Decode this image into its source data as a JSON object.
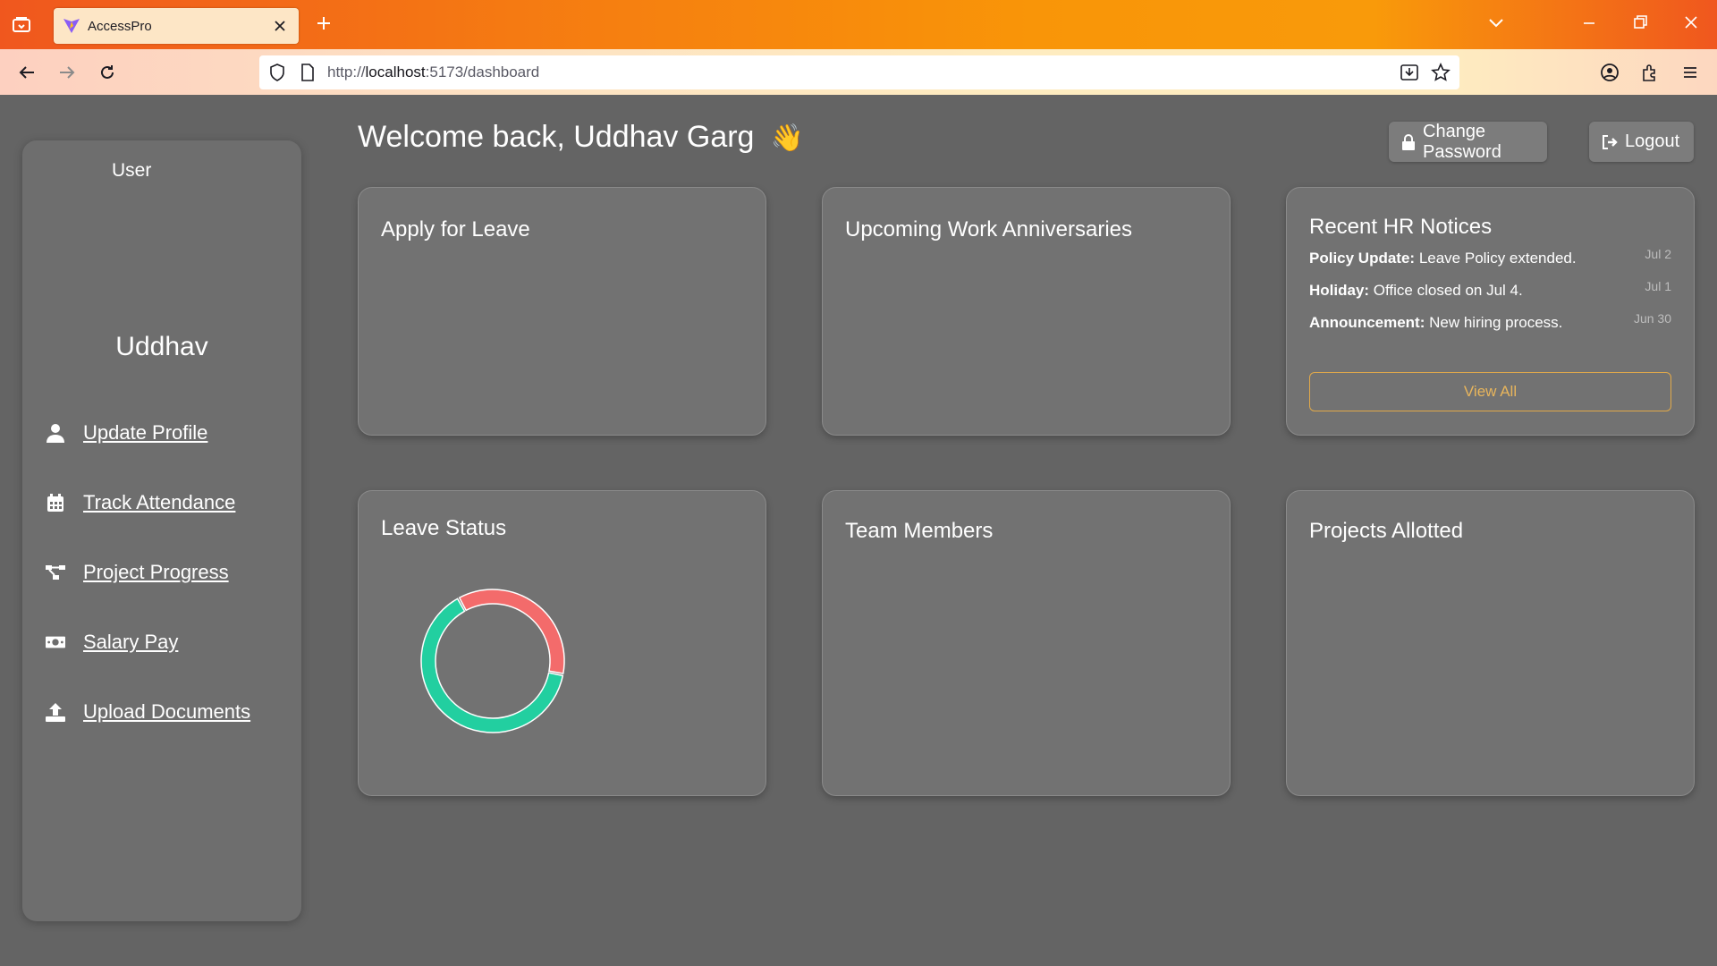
{
  "browser": {
    "tab_title": "AccessPro",
    "url_prefix": "http://",
    "url_host": "localhost",
    "url_rest": ":5173/dashboard"
  },
  "sidebar": {
    "role": "User",
    "name": "Uddhav",
    "items": [
      {
        "label": "Update Profile",
        "icon": "user-icon"
      },
      {
        "label": "Track Attendance",
        "icon": "calendar-icon"
      },
      {
        "label": "Project Progress",
        "icon": "project-diagram-icon"
      },
      {
        "label": "Salary Pay",
        "icon": "money-bill-icon"
      },
      {
        "label": "Upload Documents",
        "icon": "upload-icon"
      }
    ]
  },
  "header": {
    "welcome": "Welcome back, Uddhav Garg",
    "wave": "👋",
    "change_password": "Change Password",
    "logout": "Logout"
  },
  "cards": {
    "apply_leave": "Apply for Leave",
    "anniversaries": "Upcoming Work Anniversaries",
    "hr_notices": {
      "title": "Recent HR Notices",
      "items": [
        {
          "label": "Policy Update:",
          "text": " Leave Policy extended.",
          "date": "Jul 2"
        },
        {
          "label": "Holiday:",
          "text": " Office closed on Jul 4.",
          "date": "Jul 1"
        },
        {
          "label": "Announcement:",
          "text": " New hiring process.",
          "date": "Jun 30"
        }
      ],
      "view_all": "View All"
    },
    "leave_status": "Leave Status",
    "team_members": "Team Members",
    "projects_allotted": "Projects Allotted"
  },
  "chart_data": {
    "type": "pie",
    "title": "Leave Status",
    "series": [
      {
        "values": [
          36,
          64
        ],
        "colors": [
          "#f36b6b",
          "#22cfa0"
        ]
      }
    ]
  },
  "colors": {
    "page_bg": "#646464",
    "card_bg": "#727272",
    "accent_orange": "#e8b55c",
    "donut_red": "#f36b6b",
    "donut_green": "#22cfa0"
  }
}
